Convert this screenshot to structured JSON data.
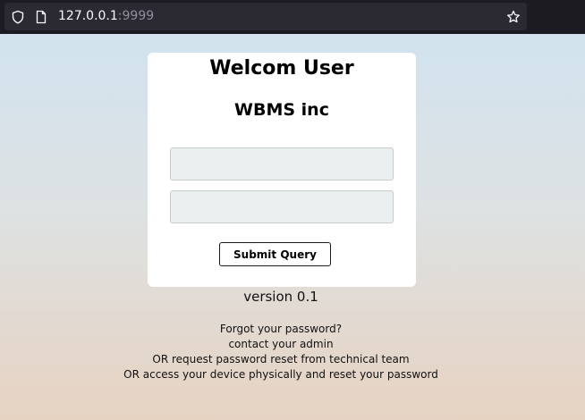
{
  "browser": {
    "url_host": "127.0.0.1",
    "url_port": ":9999",
    "icons": [
      "shield-icon",
      "page-icon",
      "star-icon"
    ]
  },
  "login": {
    "title": "Welcom User",
    "subtitle": "WBMS inc",
    "username_value": "",
    "password_value": "",
    "submit_label": "Submit Query"
  },
  "footer": {
    "version": "version 0.1",
    "help_lines": [
      "Forgot your password?",
      "contact your admin",
      "OR request password reset from technical team",
      "OR access your device physically and reset your password"
    ]
  },
  "colors": {
    "toolbar_bg": "#1c1b22",
    "urlbar_bg": "#2b2a33",
    "card_bg": "#ffffff",
    "field_bg": "#eceff0"
  }
}
